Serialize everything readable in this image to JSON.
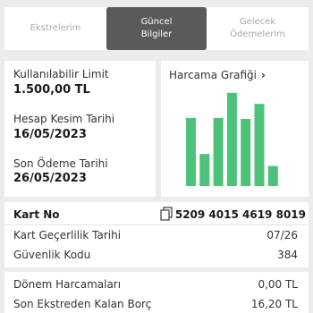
{
  "tabs": [
    {
      "label": "Ekstrelerim",
      "active": false
    },
    {
      "label": "Güncel\nBilgiler",
      "active": true
    },
    {
      "label": "Gelecek\nÖdemelerim",
      "active": false
    }
  ],
  "limit_card": {
    "limit_label": "Kullanılabilir Limit",
    "limit_value": "1.500,00 TL",
    "cut_label": "Hesap Kesim Tarihi",
    "cut_value": "16/05/2023",
    "due_label": "Son Ödeme Tarihi",
    "due_value": "26/05/2023"
  },
  "graph_card": {
    "title": "Harcama Grafiği",
    "chevron_icon": "chevron-right-icon",
    "bar_color": "#4ec27a"
  },
  "chart_data": {
    "type": "bar",
    "values": [
      0.68,
      0.32,
      0.68,
      0.93,
      0.67,
      0.82,
      0.2
    ]
  },
  "kart_card": {
    "title": "Kart No",
    "copy_icon": "copy-icon",
    "number": "5209 4015 4619 8019",
    "rows": [
      {
        "label": "Kart Geçerlilik Tarihi",
        "value": "07/26"
      },
      {
        "label": "Güvenlik Kodu",
        "value": "384"
      }
    ]
  },
  "harcama_card": {
    "rows": [
      {
        "label": "Dönem Harcamaları",
        "value": "0,00 TL"
      },
      {
        "label": "Son Ekstreden Kalan Borç",
        "value": "16,20 TL"
      }
    ]
  },
  "colors": {
    "accent_green": "#4ec27a",
    "active_tab": "#5a5a5a",
    "background": "#ececec"
  }
}
